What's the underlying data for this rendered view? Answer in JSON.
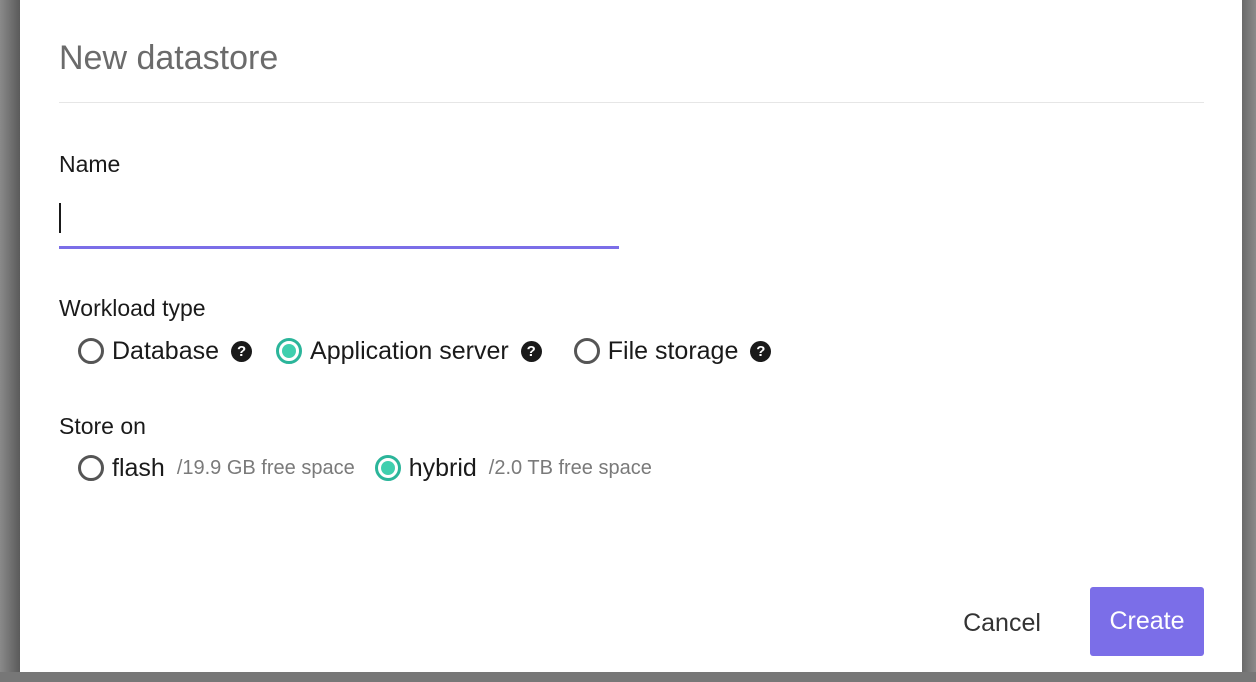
{
  "dialog": {
    "title": "New datastore",
    "name_label": "Name",
    "name_value": "",
    "workload_label": "Workload type",
    "workload_options": [
      {
        "label": "Database",
        "checked": false,
        "help_icon": "question-circle-icon"
      },
      {
        "label": "Application server",
        "checked": true,
        "help_icon": "question-circle-icon"
      },
      {
        "label": "File storage",
        "checked": false,
        "help_icon": "question-circle-icon"
      }
    ],
    "store_label": "Store on",
    "store_options": [
      {
        "label": "flash",
        "free_space": "/19.9 GB free space",
        "checked": false
      },
      {
        "label": "hybrid",
        "free_space": "/2.0 TB free space",
        "checked": true
      }
    ],
    "help_glyph": "?",
    "cancel_label": "Cancel",
    "create_label": "Create"
  },
  "colors": {
    "accent": "#7b6ee8",
    "radio_checked": "#3fcfae",
    "title_text": "#6b6b6b"
  }
}
